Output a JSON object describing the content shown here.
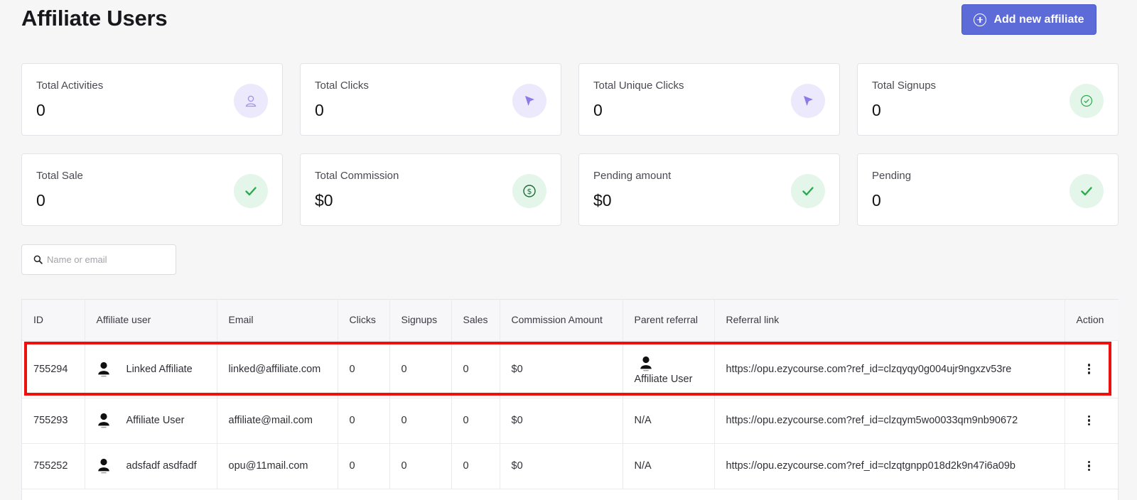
{
  "page": {
    "title": "Affiliate Users",
    "add_button_label": "Add new affiliate"
  },
  "stats": [
    {
      "label": "Total Activities",
      "value": "0",
      "icon": "user-outline-icon"
    },
    {
      "label": "Total Clicks",
      "value": "0",
      "icon": "cursor-arrow-icon"
    },
    {
      "label": "Total Unique Clicks",
      "value": "0",
      "icon": "cursor-arrow-icon"
    },
    {
      "label": "Total Signups",
      "value": "0",
      "icon": "check-circle-icon"
    },
    {
      "label": "Total Sale",
      "value": "0",
      "icon": "check-icon"
    },
    {
      "label": "Total Commission",
      "value": "$0",
      "icon": "dollar-circle-icon"
    },
    {
      "label": "Pending amount",
      "value": "$0",
      "icon": "check-icon"
    },
    {
      "label": "Pending",
      "value": "0",
      "icon": "check-icon"
    }
  ],
  "colors": {
    "accent": "#5c6bd8",
    "icon_purple": "#8a7be8",
    "icon_green": "#2fa84f",
    "highlight": "#ee0f0f"
  },
  "search": {
    "placeholder": "Name or email",
    "value": ""
  },
  "table": {
    "columns": [
      "ID",
      "Affiliate user",
      "Email",
      "Clicks",
      "Signups",
      "Sales",
      "Commission Amount",
      "Parent referral",
      "Referral link",
      "Action"
    ],
    "rows": [
      {
        "id": "755294",
        "user": "Linked Affiliate",
        "email": "linked@affiliate.com",
        "clicks": "0",
        "signups": "0",
        "sales": "0",
        "commission": "$0",
        "parent_referral": "Affiliate User",
        "referral_link": "https://opu.ezycourse.com?ref_id=clzqyqy0g004ujr9ngxzv53re",
        "highlighted": true
      },
      {
        "id": "755293",
        "user": "Affiliate User",
        "email": "affiliate@mail.com",
        "clicks": "0",
        "signups": "0",
        "sales": "0",
        "commission": "$0",
        "parent_referral": "N/A",
        "referral_link": "https://opu.ezycourse.com?ref_id=clzqym5wo0033qm9nb90672",
        "highlighted": false
      },
      {
        "id": "755252",
        "user": "adsfadf asdfadf",
        "email": "opu@11mail.com",
        "clicks": "0",
        "signups": "0",
        "sales": "0",
        "commission": "$0",
        "parent_referral": "N/A",
        "referral_link": "https://opu.ezycourse.com?ref_id=clzqtgnpp018d2k9n47i6a09b",
        "highlighted": false
      }
    ]
  }
}
